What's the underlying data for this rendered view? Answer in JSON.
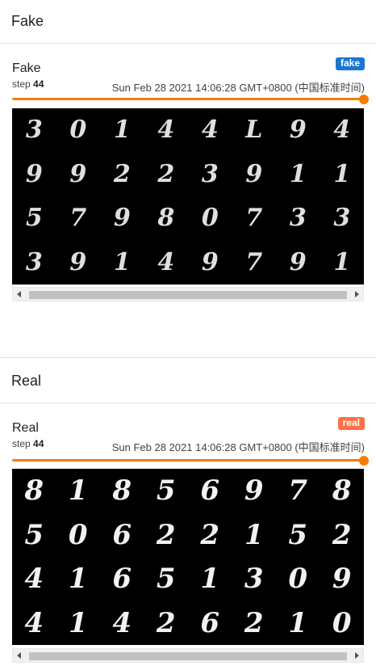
{
  "sections": {
    "fake": {
      "header": "Fake",
      "card_title": "Fake",
      "tag": "fake",
      "tag_color": "#1976d2",
      "step_label": "step",
      "step_value": "44",
      "wall_time": "Sun Feb 28 2021 14:06:28 GMT+0800 (中国标准时间)",
      "digits": [
        "3",
        "0",
        "1",
        "4",
        "4",
        "L",
        "9",
        "4",
        "9",
        "9",
        "2",
        "2",
        "3",
        "9",
        "1",
        "1",
        "5",
        "7",
        "9",
        "8",
        "0",
        "7",
        "3",
        "3",
        "3",
        "9",
        "1",
        "4",
        "9",
        "7",
        "9",
        "1"
      ]
    },
    "real": {
      "header": "Real",
      "card_title": "Real",
      "tag": "real",
      "tag_color": "#ff7043",
      "step_label": "step",
      "step_value": "44",
      "wall_time": "Sun Feb 28 2021 14:06:28 GMT+0800 (中国标准时间)",
      "digits": [
        "8",
        "1",
        "8",
        "5",
        "6",
        "9",
        "7",
        "8",
        "5",
        "0",
        "6",
        "2",
        "2",
        "1",
        "5",
        "2",
        "4",
        "1",
        "6",
        "5",
        "1",
        "3",
        "0",
        "9",
        "4",
        "1",
        "4",
        "2",
        "6",
        "2",
        "1",
        "0"
      ]
    }
  },
  "accent_color": "#f57c00"
}
